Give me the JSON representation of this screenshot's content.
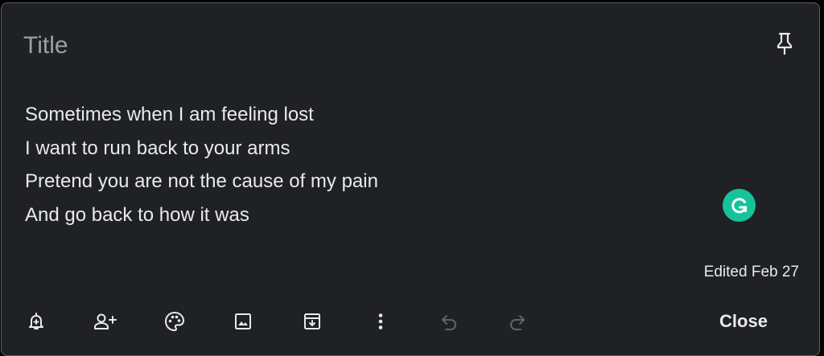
{
  "note": {
    "title_placeholder": "Title",
    "body_lines": [
      "Sometimes when I am feeling lost",
      "I want to run back to your arms",
      "Pretend you are not the cause of my pain",
      "And go back to how it was"
    ],
    "edited_label": "Edited Feb 27"
  },
  "toolbar": {
    "icons": [
      "remind-me-icon",
      "collaborator-icon",
      "background-options-icon",
      "add-image-icon",
      "archive-icon",
      "more-icon",
      "undo-icon",
      "redo-icon"
    ],
    "close_label": "Close"
  },
  "pin_icon": "pin-icon",
  "grammarly": {
    "icon": "grammarly-icon",
    "letter": "G",
    "color": "#15c39a"
  },
  "colors": {
    "background": "#202124",
    "text": "#e8eaed",
    "placeholder": "#9aa0a6",
    "icon": "#e8eaed",
    "icon_disabled": "#5f6368"
  }
}
